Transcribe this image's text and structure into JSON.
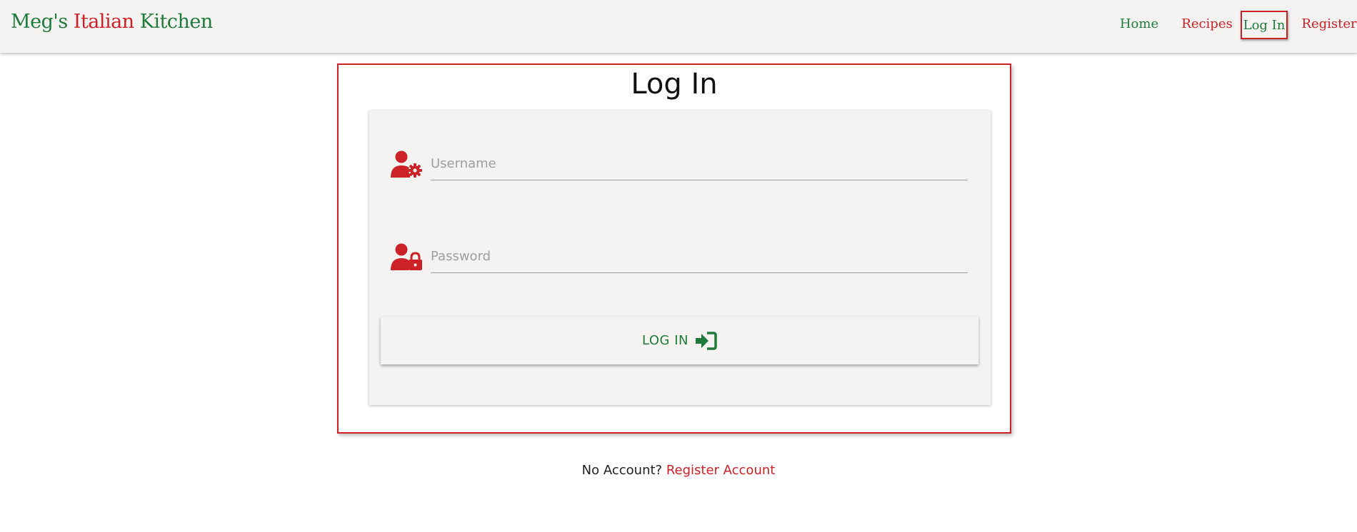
{
  "colors": {
    "brand_green": "#1e7b3a",
    "brand_red": "#cc2127",
    "nav_background": "#f4f3f1",
    "panel_background": "#f4f3f1"
  },
  "navbar": {
    "brand": {
      "part1": "Meg's ",
      "part2": "Italian",
      "part3": " Kitchen"
    },
    "links": {
      "home": "Home",
      "recipes": "Recipes",
      "login": "Log In",
      "register": "Register"
    },
    "active": "login"
  },
  "login": {
    "title": "Log In",
    "username": {
      "placeholder": "Username",
      "value": "",
      "icon": "user-gear-icon"
    },
    "password": {
      "placeholder": "Password",
      "value": "",
      "icon": "user-lock-icon"
    },
    "submit": {
      "label": "LOG IN",
      "icon": "sign-in-icon"
    }
  },
  "footer": {
    "prompt": "No Account? ",
    "register_link": "Register Account"
  }
}
